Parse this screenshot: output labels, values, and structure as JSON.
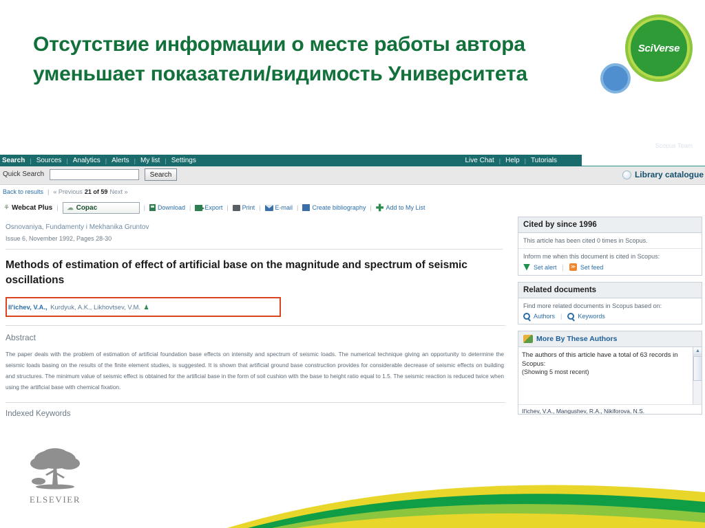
{
  "slide": {
    "title_line1": "Отсутствие информации о месте работы автора",
    "title_line2": "уменьшает показатели/видимость Университета",
    "title_color": "#12703a",
    "logo_wordmark": "SciVerse",
    "faded_watermark": "Scopus Team"
  },
  "nav": {
    "items": [
      {
        "label": "Search",
        "current": true
      },
      {
        "label": "Sources",
        "current": false
      },
      {
        "label": "Analytics",
        "current": false
      },
      {
        "label": "Alerts",
        "current": false
      },
      {
        "label": "My list",
        "current": false
      },
      {
        "label": "Settings",
        "current": false
      }
    ],
    "right_items": [
      {
        "label": "Live Chat"
      },
      {
        "label": "Help"
      },
      {
        "label": "Tutorials"
      }
    ],
    "separator": "|",
    "bg_color": "#1a6b6b"
  },
  "quick_search": {
    "label": "Quick Search",
    "value": "",
    "placeholder": "",
    "button_label": "Search",
    "library_catalogue_label": "Library catalogue"
  },
  "results_bar": {
    "back_label": "Back to results",
    "previous_label": "« Previous",
    "position": "21 of 59",
    "next_label": "Next »",
    "separator": "|"
  },
  "toolbar": {
    "webcat_label": "Webcat Plus",
    "copac_label": "Copac",
    "items": [
      {
        "label": "Download",
        "icon": "download-icon"
      },
      {
        "label": "Export",
        "icon": "export-icon"
      },
      {
        "label": "Print",
        "icon": "print-icon"
      },
      {
        "label": "E-mail",
        "icon": "email-icon"
      },
      {
        "label": "Create bibliography",
        "icon": "bibliography-icon"
      },
      {
        "label": "Add to My List",
        "icon": "plus-icon"
      }
    ],
    "separator": "|"
  },
  "article": {
    "journal": "Osnovaniya, Fundamenty i Mekhanika Gruntov",
    "issue": "Issue 6, November 1992, Pages 28-30",
    "title": "Methods of estimation of effect of artificial base on the magnitude and spectrum of seismic oscillations",
    "authors_primary": "Il'ichev, V.A.,",
    "authors_rest": "Kurdyuk, A.K., Likhovtsev, V.M.",
    "highlight_color": "#d9441f",
    "abstract_heading": "Abstract",
    "abstract_body": "The paper deals with the problem of estimation of artificial foundation base effects on intensity and spectrum of seismic loads. The numerical technique giving an opportunity to determine the seismic loads basing on the results of the finite element studies, is suggested. It is shown that artificial ground base construction provides for considerable decrease of seismic effects on building and structures. The minimum value of seismic effect is obtained for the artificial base in the form of soil cushion with the base to height ratio equal to 1.5. The seismic reaction is reduced twice when using the artificial base with chemical fixation.",
    "keywords_heading": "Indexed Keywords"
  },
  "sidebar": {
    "cited_by": {
      "heading": "Cited by since 1996",
      "count_text": "This article has been cited 0 times in Scopus.",
      "inform_text": "Inform me when this document is cited in Scopus:",
      "set_alert_label": "Set alert",
      "set_feed_label": "Set feed",
      "separator": "|"
    },
    "related": {
      "heading": "Related documents",
      "intro": "Find more related documents in Scopus based on:",
      "authors_label": "Authors",
      "keywords_label": "Keywords",
      "separator": "|"
    },
    "more_by_authors": {
      "heading": "More By These Authors",
      "total_text": "The authors of this article have a total of 63 records in Scopus:",
      "showing_text": "(Showing 5 most recent)",
      "cut_row": "Il'ichev, V.A., Mangushev, R.A., Nikiforova, N.S."
    }
  },
  "footer": {
    "elsevier_label": "ELSEVIER",
    "swoosh_colors": [
      "#f2d92a",
      "#0f9e46",
      "#8cc63e",
      "#e8d62a"
    ]
  }
}
